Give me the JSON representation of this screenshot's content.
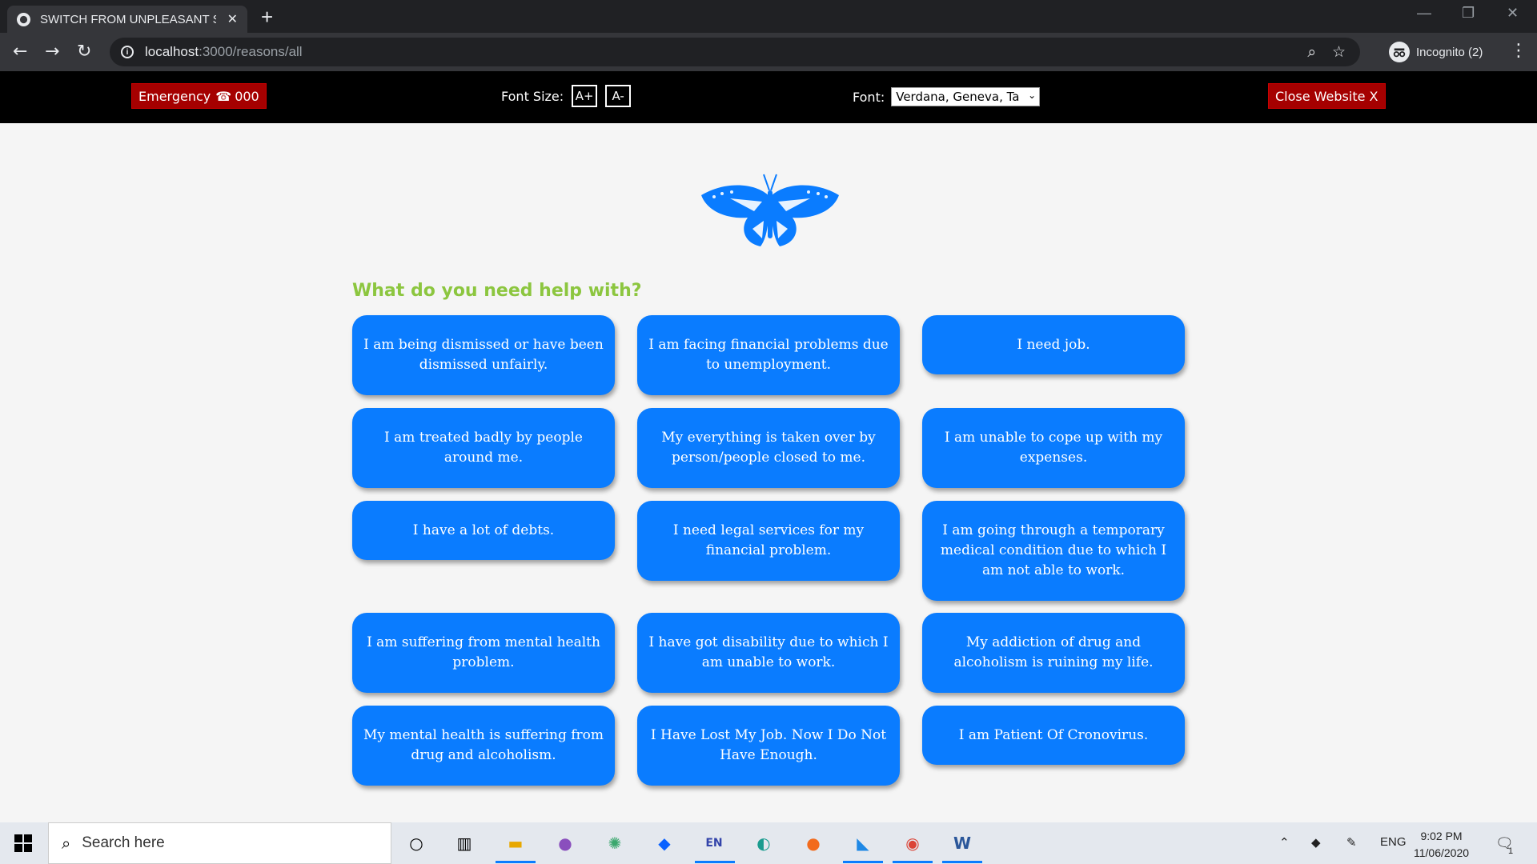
{
  "browser": {
    "tab_title": "SWITCH FROM UNPLEASANT SC",
    "tab_close": "✕",
    "new_tab": "+",
    "url_host": "localhost",
    "url_path": ":3000/reasons/all",
    "profile_label": "Incognito (2)"
  },
  "site_header": {
    "emergency_label": "Emergency",
    "emergency_number": "000",
    "font_size_label": "Font Size:",
    "increase_label": "A+",
    "decrease_label": "A-",
    "font_label": "Font:",
    "font_selected": "Verdana, Geneva, Ta",
    "close_label": "Close Website X"
  },
  "main": {
    "question": "What do you need help with?",
    "reasons": [
      "I am being dismissed or have been dismissed unfairly.",
      "I am facing financial problems due to unemployment.",
      "I need job.",
      "I am treated badly by people around me.",
      "My everything is taken over by person/people closed to me.",
      "I am unable to cope up with my expenses.",
      "I have a lot of debts.",
      "I need legal services for my financial problem.",
      "I am going through a temporary medical condition due to which I am not able to work.",
      "I am suffering from mental health problem.",
      "I have got disability due to which I am unable to work.",
      "My addiction of drug and alcoholism is ruining my life.",
      "My mental health is suffering from drug and alcoholism.",
      "I Have Lost My Job. Now I Do Not Have Enough.",
      "I am Patient Of Cronovirus."
    ]
  },
  "taskbar": {
    "search_placeholder": "Search here",
    "language": "ENG",
    "time": "9:02 PM",
    "date": "11/06/2020",
    "notification_count": "1"
  },
  "colors": {
    "accent": "#0a7cff",
    "question_green": "#8cc63f",
    "header_red": "#a50000"
  }
}
